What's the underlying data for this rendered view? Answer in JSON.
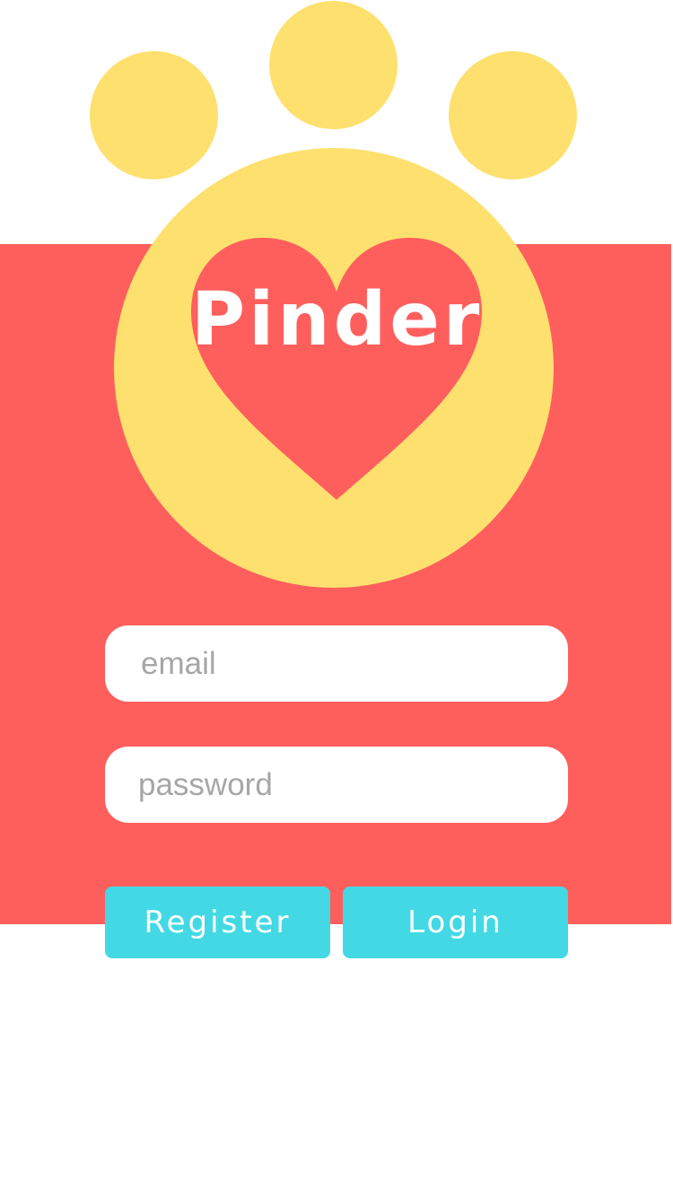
{
  "app": {
    "name": "Pinder"
  },
  "logo": {
    "paw_color": "#fee06f",
    "heart_color": "#fe5f5d",
    "icon": "paw-heart-logo"
  },
  "form": {
    "email": {
      "value": "",
      "placeholder": "email"
    },
    "password": {
      "value": "",
      "placeholder": "password"
    }
  },
  "actions": {
    "register_label": "Register",
    "login_label": "Login"
  },
  "colors": {
    "background": "#ffffff",
    "band": "#fe5f5d",
    "button": "#43d9e4",
    "text_on_brand": "#ffffff",
    "placeholder": "#a6a6a6"
  }
}
